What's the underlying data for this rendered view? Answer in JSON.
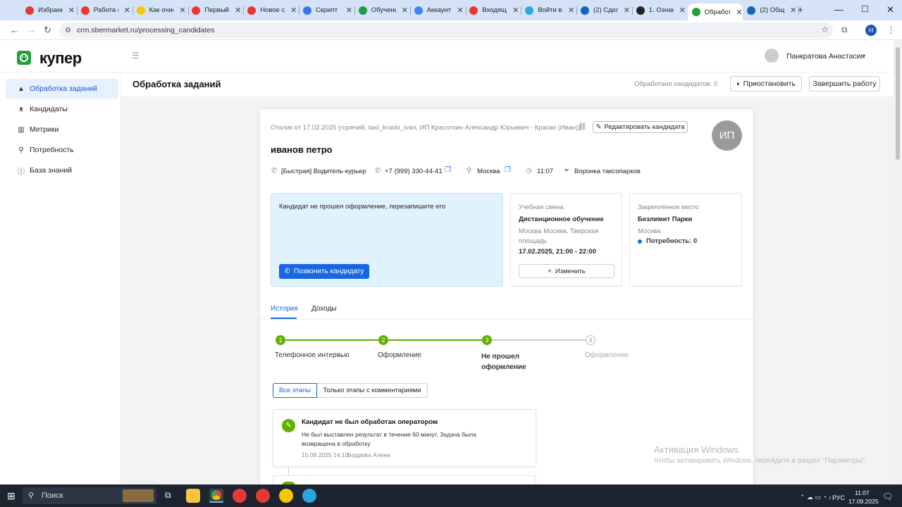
{
  "browser": {
    "tabs": [
      {
        "label": "Избранное",
        "fav": "#e53935"
      },
      {
        "label": "Работа с",
        "fav": "#e53935"
      },
      {
        "label": "Как очис",
        "fav": "#f7c600"
      },
      {
        "label": "Первый",
        "fav": "#e53935"
      },
      {
        "label": "Новое с",
        "fav": "#e53935"
      },
      {
        "label": "Скрипт",
        "fav": "#3b78e7"
      },
      {
        "label": "Обучение",
        "fav": "#1e9e4a"
      },
      {
        "label": "Аккаунт",
        "fav": "#4285f4"
      },
      {
        "label": "Входящи",
        "fav": "#e53935"
      },
      {
        "label": "Войти в",
        "fav": "#29a9e0"
      },
      {
        "label": "(2) Сдел",
        "fav": "#1565c0"
      },
      {
        "label": "1. Ознак",
        "fav": "#222"
      },
      {
        "label": "Обработ",
        "fav": "#21a038"
      },
      {
        "label": "(2) Общ",
        "fav": "#1565c0"
      }
    ],
    "url": "crm.sbermarket.ru/processing_candidates",
    "profile_initial": "Н"
  },
  "app": {
    "logo": "купер",
    "user": "Панкратова Анастасия",
    "page_title": "Обработка заданий",
    "processed": "Обработано кандидатов: 0",
    "pause_label": "Приостановить",
    "finish_label": "Завершить работу"
  },
  "sidebar": {
    "items": [
      {
        "label": "Обработка заданий",
        "icon": "hat-icon"
      },
      {
        "label": "Кандидаты",
        "icon": "people-icon"
      },
      {
        "label": "Метрики",
        "icon": "chart-icon"
      },
      {
        "label": "Потребность",
        "icon": "search-icon"
      },
      {
        "label": "База знаний",
        "icon": "info-icon"
      }
    ]
  },
  "candidate": {
    "response": "Отклик от 17.02.2025 (горячий, taxi_kraski_ivan, ИП Красоткин Александр Юрьевич - Краски (Иван))",
    "edit_label": "Редактировать кандидата",
    "avatar": "ИП",
    "name": "иванов петро",
    "vacancy": "[Быстрая] Водитель-курьер",
    "phone": "+7 (999) 330-44-41",
    "city": "Москва",
    "time": "11:07",
    "funnel": "Воронка таксопарков",
    "status_text": "Кандидат не прошел оформление, перезапишите его",
    "call_label": "Позвонить кандидату",
    "shift": {
      "title": "Учебная смена",
      "name": "Дистанционное обучение",
      "place": "Москва Москва, Тверская площадь",
      "date": "17.02.2025, 21:00 - 22:00",
      "change_label": "Изменить"
    },
    "place": {
      "title": "Закреплённое место",
      "name": "Безлимит Парки",
      "city": "Москва",
      "need": "Потребность: 0"
    }
  },
  "tabs": {
    "history": "История",
    "income": "Доходы"
  },
  "steps": [
    {
      "num": "1",
      "label": "Телефонное интервью"
    },
    {
      "num": "2",
      "label": "Оформление"
    },
    {
      "num": "3",
      "label": "Не прошел оформление"
    },
    {
      "num": "4",
      "label": "Оформление"
    }
  ],
  "filters": {
    "all": "Все этапы",
    "comments": "Только этапы с комментариями"
  },
  "event": {
    "title": "Кандидат не был обработан оператором",
    "text": "Не был выставлен результат в течение 60 минут. Задача была возвращена в обработку",
    "meta_date": "15.09.2025 14:10",
    "meta_author": "Бодрова Алена"
  },
  "watermark": {
    "title": "Активация Windows",
    "text": "Чтобы активировать Windows, перейдите в раздел \"Параметры\"."
  },
  "taskbar": {
    "search": "Поиск",
    "lang": "РУС",
    "clock_time": "11:07",
    "clock_date": "17.09.2025"
  }
}
